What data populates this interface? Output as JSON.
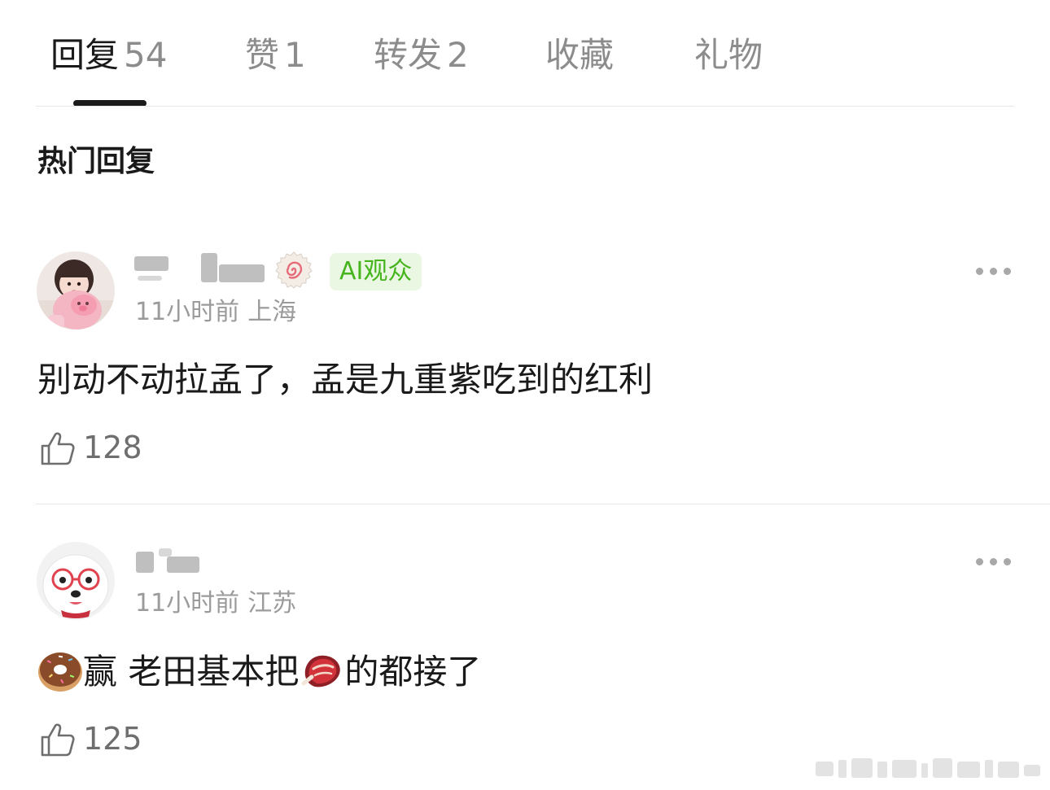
{
  "tabs": [
    {
      "label": "回复",
      "count": "54"
    },
    {
      "label": "赞",
      "count": "1"
    },
    {
      "label": "转发",
      "count": "2"
    },
    {
      "label": "收藏",
      "count": ""
    },
    {
      "label": "礼物",
      "count": ""
    }
  ],
  "active_tab": "回复",
  "section_title": "热门回复",
  "comments": [
    {
      "badge": "AI观众",
      "time": "11小时前",
      "location": "上海",
      "text": "别动不动拉孟了，孟是九重紫吃到的红利",
      "likes": "128",
      "avatar_icon": "baby-with-toy-avatar",
      "badge_icon": "swirl-badge-icon"
    },
    {
      "time": "11小时前",
      "location": "江苏",
      "text_prefix_icon": "donut-emoji",
      "text_part1": "赢 老田基本把",
      "text_mid_icon": "steak-emoji",
      "text_part2": "的都接了",
      "likes": "125",
      "avatar_icon": "dog-with-glasses-avatar"
    }
  ],
  "colors": {
    "accent_green": "#46b51d",
    "badge_bg": "#e9f7e3",
    "meta_gray": "#9b9b9b",
    "active_text": "#1a1a1a",
    "inactive_text": "#8c8c8c"
  }
}
